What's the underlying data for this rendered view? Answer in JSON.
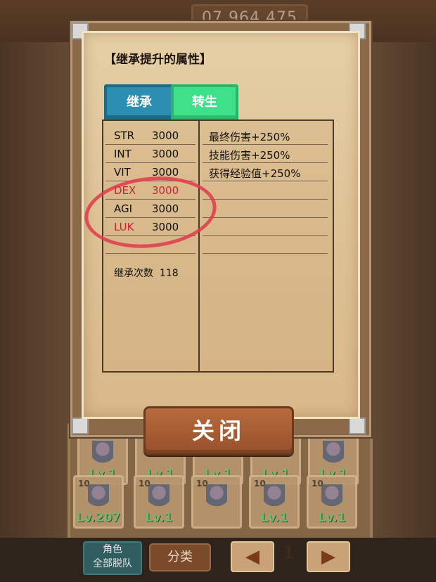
{
  "top": {
    "counter": "07 964 475"
  },
  "panel": {
    "title": "【继承提升的属性】",
    "tabs": [
      {
        "label": "继承",
        "active": true
      },
      {
        "label": "转生",
        "active": false
      }
    ],
    "stats": [
      {
        "name": "STR",
        "value": "3000",
        "highlight": false
      },
      {
        "name": "INT",
        "value": "3000",
        "highlight": false
      },
      {
        "name": "VIT",
        "value": "3000",
        "highlight": false
      },
      {
        "name": "DEX",
        "value": "3000",
        "highlight": true
      },
      {
        "name": "AGI",
        "value": "3000",
        "highlight": false
      },
      {
        "name": "LUK",
        "value": "3000",
        "highlight": true
      }
    ],
    "bonuses": [
      "最终伤害+250%",
      "技能伤害+250%",
      "获得经验值+250%"
    ],
    "inherit_count_label": "继承次数",
    "inherit_count_value": "118",
    "close_label": "关闭"
  },
  "grid": {
    "row1": [
      {
        "level": "Lv.1"
      },
      {
        "level": "Lv.1"
      },
      {
        "level": "Lv.1"
      },
      {
        "level": "Lv.1"
      },
      {
        "level": "Lv.1"
      }
    ],
    "row2": [
      {
        "count": "10",
        "level": "Lv.207"
      },
      {
        "count": "10",
        "level": "Lv.1"
      },
      {
        "count": "10",
        "level": ""
      },
      {
        "count": "10",
        "level": "Lv.1"
      },
      {
        "count": "10",
        "level": "Lv.1"
      }
    ]
  },
  "bottom": {
    "role_label": "角色",
    "disband_label": "全部脱队",
    "category_label": "分类",
    "prev_label": "◀",
    "next_label": "▶",
    "page": "1"
  },
  "colors": {
    "tab_inherit": "#2c8fb1",
    "tab_rebirth": "#3ee08a",
    "highlight_red": "#cc2233",
    "annotation_circle": "#e03a4a"
  }
}
